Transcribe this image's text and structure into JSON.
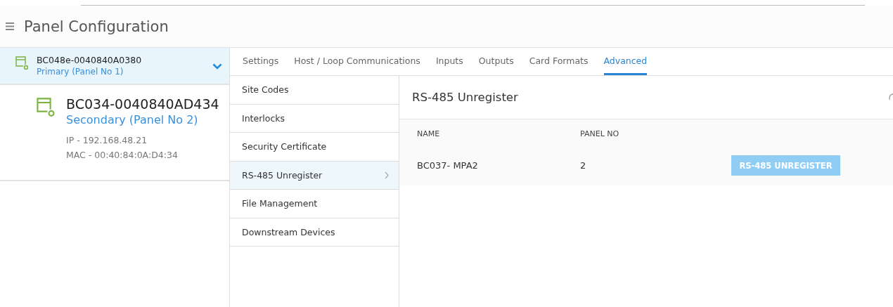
{
  "header": {
    "title": "Panel Configuration"
  },
  "panels": [
    {
      "name": "BC048e-0040840A0380",
      "role": "Primary (Panel No 1)",
      "selected": true,
      "expanded": true
    },
    {
      "name": "BC034-0040840AD434",
      "role": "Secondary (Panel No 2)",
      "selected": false,
      "ip": "IP - 192.168.48.21",
      "mac": "MAC - 00:40:84:0A:D4:34"
    }
  ],
  "tabs": [
    {
      "label": "Settings",
      "selected": false
    },
    {
      "label": "Host / Loop Communications",
      "selected": false
    },
    {
      "label": "Inputs",
      "selected": false
    },
    {
      "label": "Outputs",
      "selected": false
    },
    {
      "label": "Card Formats",
      "selected": false
    },
    {
      "label": "Advanced",
      "selected": true
    }
  ],
  "submenu": [
    {
      "label": "Site Codes",
      "selected": false
    },
    {
      "label": "Interlocks",
      "selected": false
    },
    {
      "label": "Security Certificate",
      "selected": false
    },
    {
      "label": "RS-485 Unregister",
      "selected": true
    },
    {
      "label": "File Management",
      "selected": false
    },
    {
      "label": "Downstream Devices",
      "selected": false
    }
  ],
  "content": {
    "title": "RS-485 Unregister",
    "columns": [
      "NAME",
      "PANEL NO"
    ],
    "rows": [
      {
        "name": "BC037- MPA2",
        "panel_no": "2",
        "action": "RS-485 UNREGISTER",
        "disabled": true
      }
    ]
  }
}
